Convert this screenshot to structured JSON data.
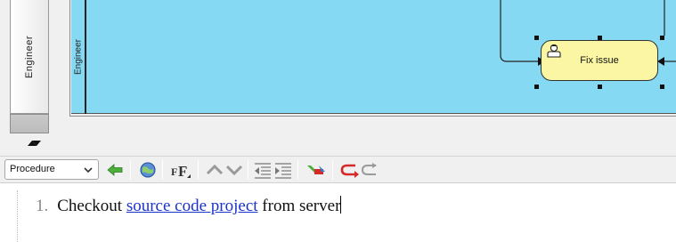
{
  "diagram": {
    "lane_header_label": "Engineer",
    "lane_label": "Engineer",
    "task": {
      "label": "Fix issue",
      "icon": "user-task-icon"
    }
  },
  "toolbar": {
    "mode_select": {
      "value": "Procedure"
    },
    "buttons": [
      {
        "name": "back-arrow-icon"
      },
      {
        "name": "globe-link-icon"
      },
      {
        "name": "format-font-icon"
      },
      {
        "name": "move-up-icon"
      },
      {
        "name": "move-down-icon"
      },
      {
        "name": "outdent-icon"
      },
      {
        "name": "indent-icon"
      },
      {
        "name": "remove-step-icon"
      },
      {
        "name": "undo-icon"
      },
      {
        "name": "redo-icon"
      }
    ]
  },
  "editor": {
    "steps": [
      {
        "number": "1.",
        "before": "Checkout ",
        "link": "source code project",
        "after": " from server"
      }
    ]
  },
  "colors": {
    "lane": "#86d9f2",
    "task_fill": "#fbf6a3",
    "link": "#1a33cc",
    "arrow_green": "#2e9a2e",
    "arrow_red": "#d42a2a"
  }
}
